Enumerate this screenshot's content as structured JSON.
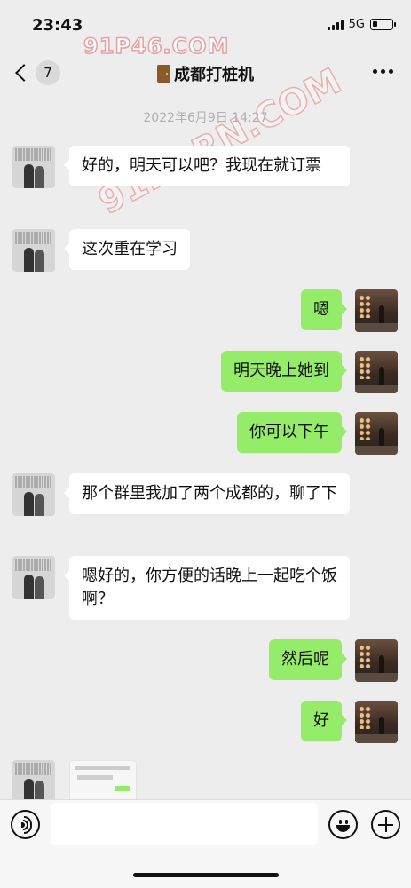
{
  "status_bar": {
    "time": "23:43",
    "network": "5G"
  },
  "header": {
    "back_badge": "7",
    "title": "成都打桩机",
    "title_icon": "door-icon",
    "more_icon": "more-icon"
  },
  "watermarks": {
    "top": "91P46.COM",
    "diagonal": "91PORN.COM"
  },
  "chat": {
    "timestamp": "2022年6月9日 14:27",
    "messages": [
      {
        "side": "left",
        "text": "好的，明天可以吧？我现在就订票"
      },
      {
        "side": "left",
        "text": "这次重在学习"
      },
      {
        "side": "right",
        "text": "嗯"
      },
      {
        "side": "right",
        "text": "明天晚上她到"
      },
      {
        "side": "right",
        "text": "你可以下午"
      },
      {
        "side": "left",
        "text": "那个群里我加了两个成都的，聊了下"
      },
      {
        "side": "left",
        "text": "嗯好的，你方便的话晚上一起吃个饭啊？"
      },
      {
        "side": "right",
        "text": "然后呢"
      },
      {
        "side": "right",
        "text": "好"
      },
      {
        "side": "left",
        "type": "image",
        "text": ""
      }
    ]
  },
  "input_bar": {
    "voice_icon": "voice-icon",
    "emoji_icon": "emoji-icon",
    "plus_icon": "plus-icon",
    "placeholder": ""
  },
  "colors": {
    "background": "#ededed",
    "bubble_right": "#95ec69",
    "bubble_left": "#ffffff",
    "timestamp": "#b0b0b0"
  }
}
